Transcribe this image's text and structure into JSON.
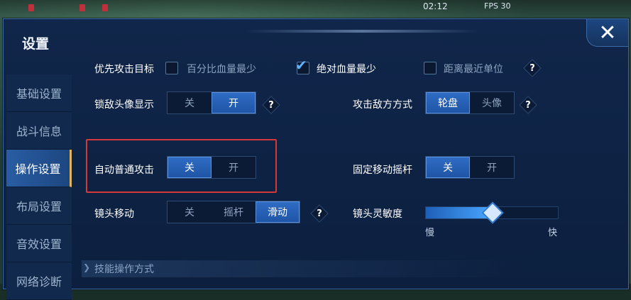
{
  "hud": {
    "clock": "02:12",
    "fps": "FPS 30"
  },
  "panel": {
    "title": "设置",
    "close_icon": "close-icon"
  },
  "sidebar": {
    "items": [
      {
        "label": "基础设置",
        "active": false
      },
      {
        "label": "战斗信息",
        "active": false
      },
      {
        "label": "操作设置",
        "active": true
      },
      {
        "label": "布局设置",
        "active": false
      },
      {
        "label": "音效设置",
        "active": false
      },
      {
        "label": "网络诊断",
        "active": false
      }
    ]
  },
  "settings": {
    "priority_target": {
      "label": "优先攻击目标",
      "options": [
        {
          "label": "百分比血量最少",
          "checked": false
        },
        {
          "label": "绝对血量最少",
          "checked": true
        },
        {
          "label": "距离最近单位",
          "checked": false
        }
      ],
      "help": "?"
    },
    "lock_avatar": {
      "label": "锁敌头像显示",
      "options": [
        "关",
        "开"
      ],
      "selected": "开",
      "help": "?"
    },
    "attack_mode": {
      "label": "攻击敌方方式",
      "options": [
        "轮盘",
        "头像"
      ],
      "selected": "轮盘",
      "help": "?"
    },
    "auto_attack": {
      "label": "自动普通攻击",
      "options": [
        "关",
        "开"
      ],
      "selected": "关"
    },
    "fixed_joystick": {
      "label": "固定移动摇杆",
      "options": [
        "关",
        "开"
      ],
      "selected": "关"
    },
    "camera_move": {
      "label": "镜头移动",
      "options": [
        "关",
        "摇杆",
        "滑动"
      ],
      "selected": "滑动",
      "help": "?"
    },
    "camera_sensitivity": {
      "label": "镜头灵敏度",
      "min_label": "慢",
      "max_label": "快",
      "value": 0.5
    },
    "skill_section": {
      "title": "技能操作方式"
    }
  },
  "colors": {
    "accent": "#2f6cc4",
    "highlight": "#d23a3a",
    "panel_bg": "#0c1f3f"
  }
}
